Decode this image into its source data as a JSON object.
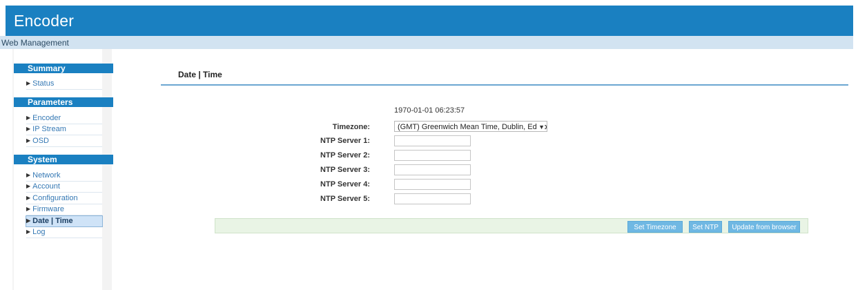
{
  "header": {
    "title": "Encoder"
  },
  "subbar": {
    "text": "Web Management"
  },
  "sidebar": {
    "sections": [
      {
        "title": "Summary",
        "items": [
          "Status"
        ]
      },
      {
        "title": "Parameters",
        "items": [
          "Encoder",
          "IP Stream",
          "OSD"
        ]
      },
      {
        "title": "System",
        "items": [
          "Network",
          "Account",
          "Configuration",
          "Firmware",
          "Date | Time",
          "Log"
        ]
      }
    ],
    "active_item": "Date | Time"
  },
  "main": {
    "title": "Date | Time",
    "current_datetime": "1970-01-01 06:23:57",
    "timezone": {
      "label": "Timezone:",
      "value": "(GMT) Greenwich Mean Time, Dublin, Edinburgh"
    },
    "ntp": [
      {
        "label": "NTP Server 1:",
        "value": ""
      },
      {
        "label": "NTP Server 2:",
        "value": ""
      },
      {
        "label": "NTP Server 3:",
        "value": ""
      },
      {
        "label": "NTP Server 4:",
        "value": ""
      },
      {
        "label": "NTP Server 5:",
        "value": ""
      }
    ],
    "buttons": {
      "set_timezone": "Set Timezone",
      "set_ntp": "Set NTP",
      "update_from_browser": "Update from browser"
    }
  },
  "colors": {
    "brand": "#1a80c1",
    "subbar": "#d2e3f1",
    "button": "#6fb8e3",
    "button_bar": "#e9f4e5"
  }
}
